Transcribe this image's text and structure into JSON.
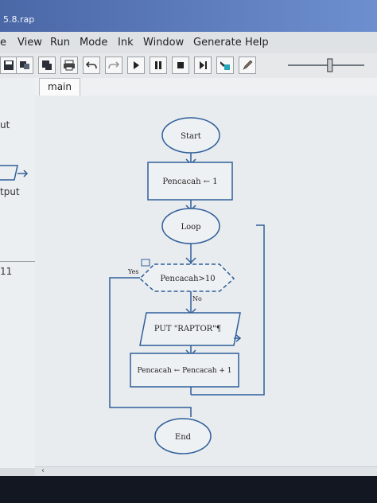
{
  "window": {
    "title": "5.8.rap"
  },
  "menu": {
    "items": [
      "e",
      "View",
      "Run",
      "Mode",
      "Ink",
      "Window",
      "Generate",
      "Help"
    ]
  },
  "toolbar": {
    "buttons": [
      {
        "icon": "save-icon"
      },
      {
        "icon": "cut-icon"
      },
      {
        "icon": "copy-icon"
      },
      {
        "icon": "print-icon"
      },
      {
        "icon": "undo-icon"
      },
      {
        "icon": "redo-icon"
      },
      {
        "icon": "play-icon"
      },
      {
        "icon": "pause-icon"
      },
      {
        "icon": "stop-icon"
      },
      {
        "icon": "step-icon"
      },
      {
        "icon": "tool-icon"
      },
      {
        "icon": "pen-icon"
      }
    ],
    "speed_slider": {
      "level_percent": 55
    }
  },
  "left_panel": {
    "labels": [
      "ut",
      "tput",
      "11"
    ]
  },
  "tabs": {
    "active": "main"
  },
  "flowchart": {
    "start": "Start",
    "assign1": "Pencacah ← 1",
    "loop": "Loop",
    "condition": "Pencacah>10",
    "yes_label": "Yes",
    "no_label": "No",
    "output": "PUT \"RAPTOR\"¶",
    "assign2": "Pencacah ← Pencacah + 1",
    "end": "End"
  },
  "colors": {
    "shape_stroke": "#2f5f9a",
    "canvas_bg": "#e9ecef"
  }
}
